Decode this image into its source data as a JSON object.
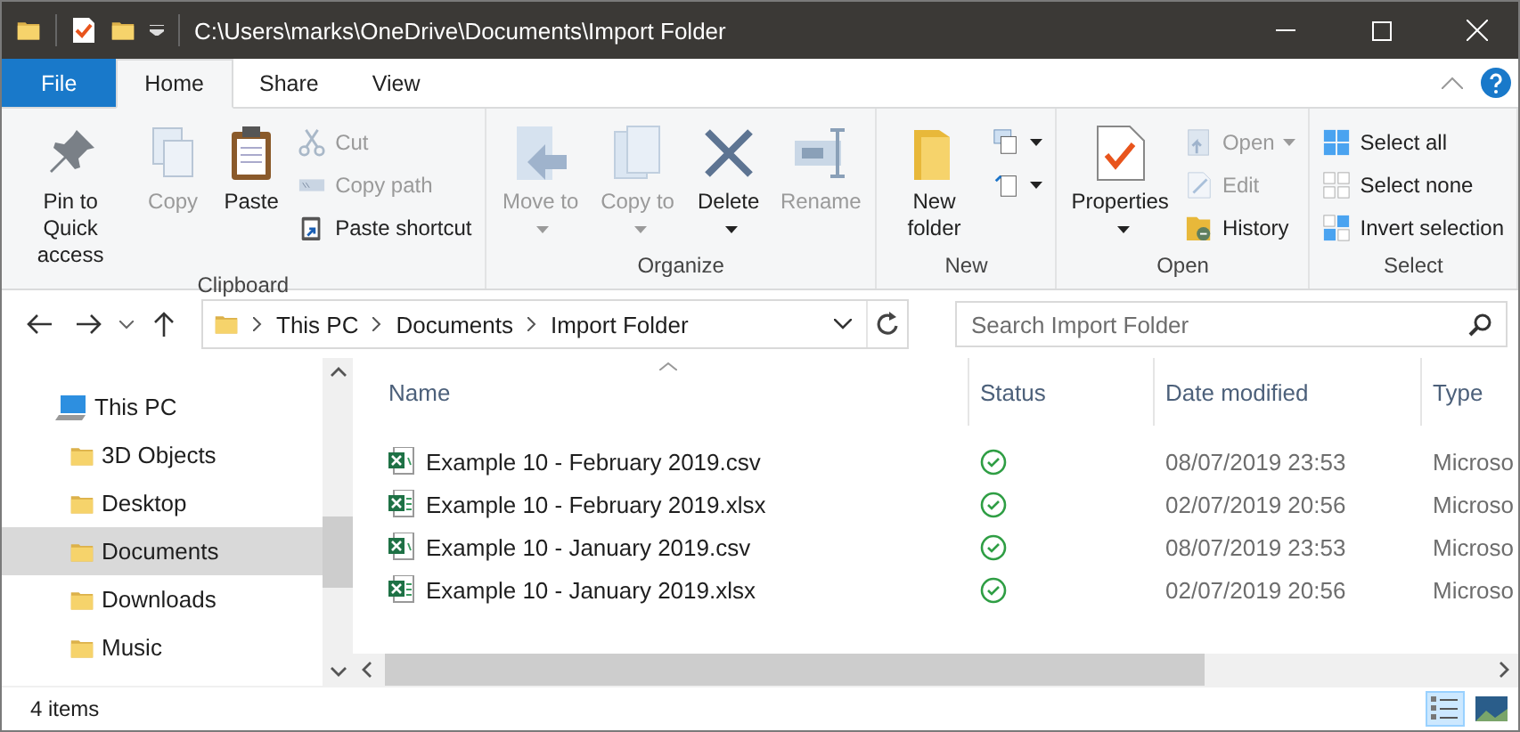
{
  "title_bar": {
    "title": "C:\\Users\\marks\\OneDrive\\Documents\\Import Folder"
  },
  "tabs": [
    {
      "label": "File",
      "kind": "file",
      "selected": false
    },
    {
      "label": "Home",
      "kind": "tab",
      "selected": true
    },
    {
      "label": "Share",
      "kind": "tab",
      "selected": false
    },
    {
      "label": "View",
      "kind": "tab",
      "selected": false
    }
  ],
  "ribbon": {
    "groups": [
      {
        "label": "Clipboard",
        "items": [
          {
            "kind": "large",
            "label": "Pin to Quick access",
            "disabled": false,
            "dropdown": false
          },
          {
            "kind": "large",
            "label": "Copy",
            "disabled": true,
            "dropdown": false
          },
          {
            "kind": "large",
            "label": "Paste",
            "disabled": false,
            "dropdown": false
          },
          {
            "kind": "stack",
            "items": [
              {
                "label": "Cut",
                "disabled": true,
                "dropdown": false
              },
              {
                "label": "Copy path",
                "disabled": true,
                "dropdown": false
              },
              {
                "label": "Paste shortcut",
                "disabled": false,
                "dropdown": false
              }
            ]
          }
        ]
      },
      {
        "label": "Organize",
        "items": [
          {
            "kind": "large",
            "label": "Move to",
            "disabled": true,
            "dropdown": true
          },
          {
            "kind": "large",
            "label": "Copy to",
            "disabled": true,
            "dropdown": true
          },
          {
            "kind": "large",
            "label": "Delete",
            "disabled": false,
            "dropdown": true
          },
          {
            "kind": "large",
            "label": "Rename",
            "disabled": true,
            "dropdown": false
          }
        ]
      },
      {
        "label": "New",
        "items": [
          {
            "kind": "large",
            "label": "New folder",
            "disabled": false,
            "dropdown": false
          },
          {
            "kind": "stack",
            "items": [
              {
                "disabled": false,
                "dropdown": true
              },
              {
                "disabled": false,
                "dropdown": true
              }
            ]
          }
        ]
      },
      {
        "label": "Open",
        "items": [
          {
            "kind": "large",
            "label": "Properties",
            "disabled": false,
            "dropdown": true
          },
          {
            "kind": "stack",
            "items": [
              {
                "label": "Open",
                "disabled": true,
                "dropdown": true
              },
              {
                "label": "Edit",
                "disabled": true,
                "dropdown": false
              },
              {
                "label": "History",
                "disabled": false,
                "dropdown": false
              }
            ]
          }
        ]
      },
      {
        "label": "Select",
        "items": [
          {
            "kind": "stack",
            "items": [
              {
                "label": "Select all",
                "disabled": false,
                "dropdown": false
              },
              {
                "label": "Select none",
                "disabled": false,
                "dropdown": false
              },
              {
                "label": "Invert selection",
                "disabled": false,
                "dropdown": false
              }
            ]
          }
        ]
      }
    ]
  },
  "address_bar": {
    "crumbs": [
      "This PC",
      "Documents",
      "Import Folder"
    ]
  },
  "search": {
    "placeholder": "Search Import Folder"
  },
  "sidebar": {
    "items": [
      {
        "label": "This PC",
        "selected": false,
        "children": [
          {
            "label": "3D Objects",
            "selected": false
          },
          {
            "label": "Desktop",
            "selected": false
          },
          {
            "label": "Documents",
            "selected": true
          },
          {
            "label": "Downloads",
            "selected": false
          },
          {
            "label": "Music",
            "selected": false
          }
        ]
      }
    ]
  },
  "table": {
    "columns": [
      "Name",
      "Status",
      "Date modified",
      "Type"
    ],
    "rows": [
      {
        "name": "Example 10 - February 2019.csv",
        "kind": "csv",
        "synced": true,
        "date": "08/07/2019 23:53",
        "type": "Microso"
      },
      {
        "name": "Example 10 - February 2019.xlsx",
        "kind": "xlsx",
        "synced": true,
        "date": "02/07/2019 20:56",
        "type": "Microso"
      },
      {
        "name": "Example 10 - January 2019.csv",
        "kind": "csv",
        "synced": true,
        "date": "08/07/2019 23:53",
        "type": "Microso"
      },
      {
        "name": "Example 10 - January 2019.xlsx",
        "kind": "xlsx",
        "synced": true,
        "date": "02/07/2019 20:56",
        "type": "Microso"
      }
    ]
  },
  "status_bar": {
    "count": "4 items",
    "views": [
      {
        "kind": "details",
        "selected": true
      },
      {
        "kind": "large-icons",
        "selected": false
      }
    ]
  }
}
